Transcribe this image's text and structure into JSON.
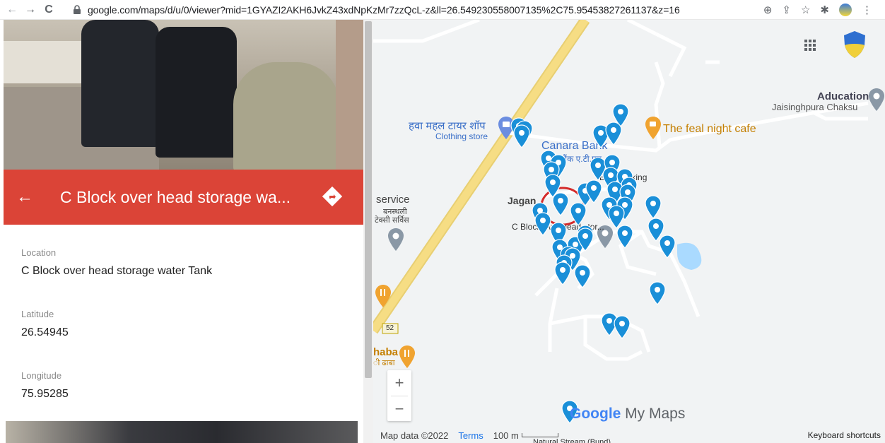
{
  "browser": {
    "url": "google.com/maps/d/u/0/viewer?mid=1GYAZI2AKH6JvkZ43xdNpKzMr7zzQcL-z&ll=26.549230558007135%2C75.95453827261137&z=16"
  },
  "panel": {
    "title": "C Block over head storage wa...",
    "fields": [
      {
        "label": "Location",
        "value": "C Block over head storage water Tank"
      },
      {
        "label": "Latitude",
        "value": "26.54945"
      },
      {
        "label": "Longitude",
        "value": "75.95285"
      }
    ]
  },
  "map": {
    "labels": {
      "hawa_mahal": "हवा महल टायर शॉप",
      "clothing_store": "Clothing store",
      "canara_bank": "Canara Bank",
      "canara_bank_hi": "केनरा बैंक ए.टी.एम",
      "feal_night_cafe": "The feal night cafe",
      "aducation": "Aducation",
      "jaisinghpura": "Jaisinghpura Chaksu",
      "bike_parking": "Bike Parking",
      "jagan": "Jagan",
      "service": "service",
      "service_hi_1": "बनस्थली",
      "service_hi_2": "टेक्सी सर्विस",
      "c_block": "C Block over head stor...",
      "route_52": "52",
      "dhaba": "haba",
      "dhaba_hi": "ी ढाबा",
      "natural_stream": "Natural Stream (Bund)"
    },
    "brand": {
      "google": "Google",
      "my_maps": " My Maps"
    },
    "footer": {
      "map_data": "Map data ©2022",
      "terms": "Terms",
      "scale": "100 m",
      "keyboard": "Keyboard shortcuts"
    },
    "zoom": {
      "in": "+",
      "out": "−"
    },
    "colors": {
      "pin": "#1a8fd8",
      "header": "#db4437",
      "highlight_circle": "#d42b2b",
      "road_highway": "#f6d97a"
    }
  }
}
